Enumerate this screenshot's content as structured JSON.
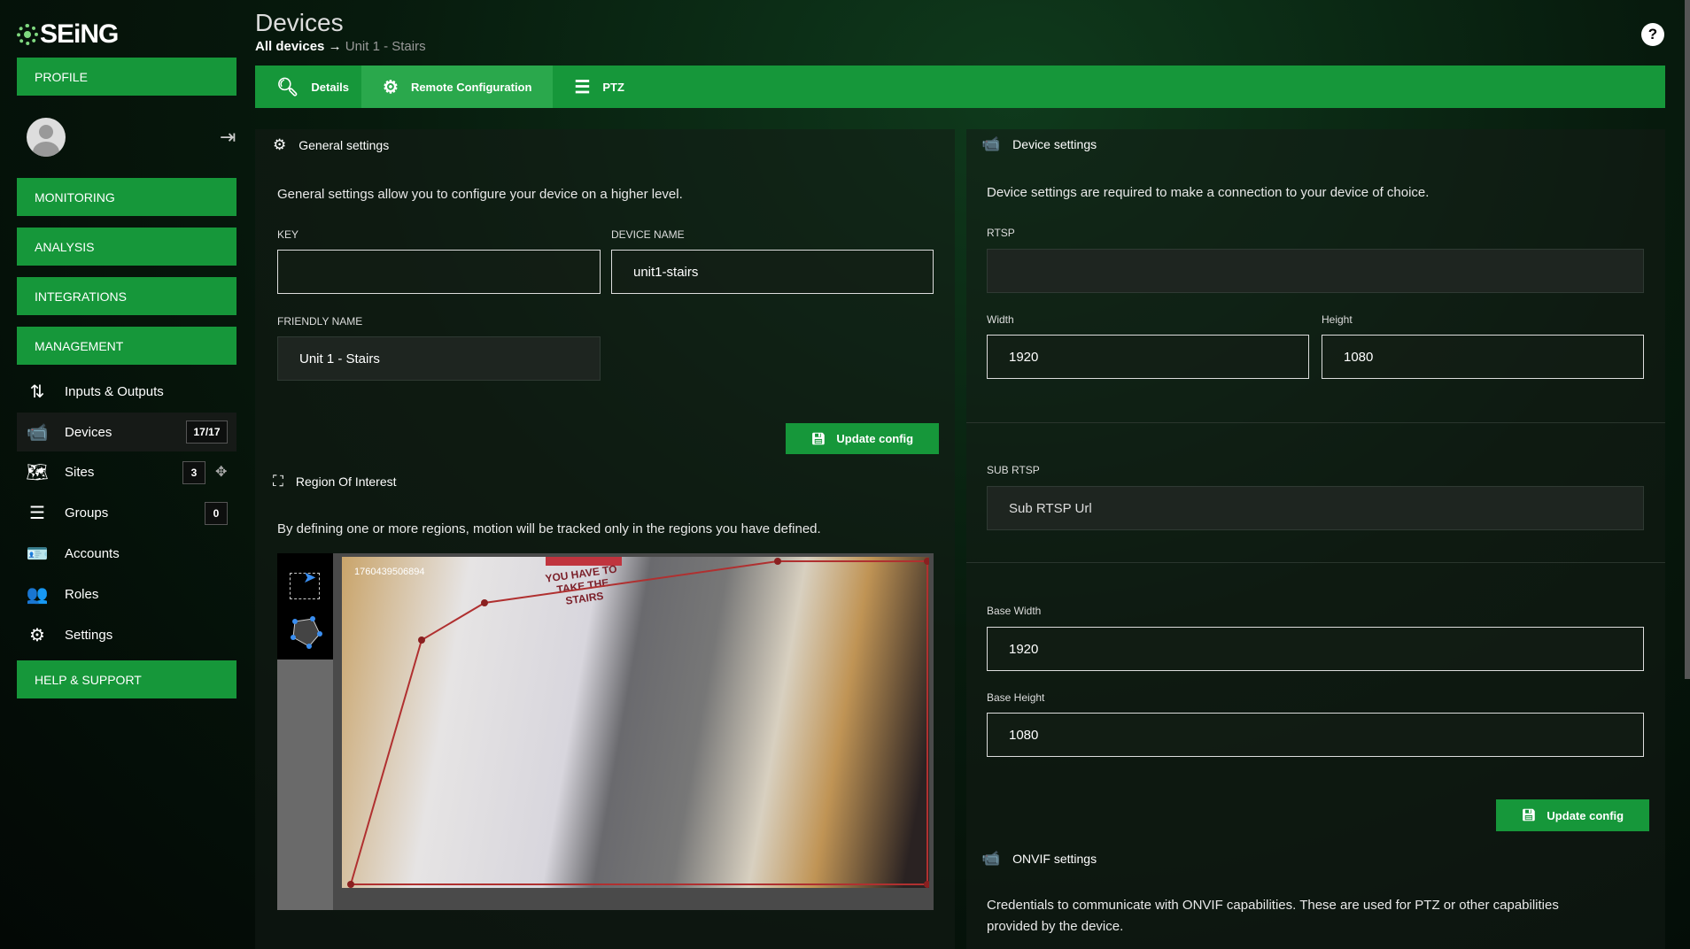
{
  "brand": {
    "name": "SEiNG",
    "accent": "#16973a"
  },
  "sidebar": {
    "profile": "PROFILE",
    "monitoring": "MONITORING",
    "analysis": "ANALYSIS",
    "integrations": "INTEGRATIONS",
    "management": "MANAGEMENT",
    "items": [
      {
        "label": "Inputs & Outputs",
        "icon": "arrows-up-down-icon"
      },
      {
        "label": "Devices",
        "icon": "cctv-camera-icon",
        "badge": "17/17"
      },
      {
        "label": "Sites",
        "icon": "map-icon",
        "badge": "3"
      },
      {
        "label": "Groups",
        "icon": "layers-icon",
        "badge": "0"
      },
      {
        "label": "Accounts",
        "icon": "id-card-icon"
      },
      {
        "label": "Roles",
        "icon": "users-gear-icon"
      },
      {
        "label": "Settings",
        "icon": "gear-icon"
      }
    ],
    "help": "HELP & SUPPORT"
  },
  "header": {
    "title": "Devices",
    "breadcrumb_root": "All devices",
    "breadcrumb_arrow": "→",
    "breadcrumb_current": "Unit 1 - Stairs",
    "help": "?"
  },
  "tabs": [
    {
      "label": "Details"
    },
    {
      "label": "Remote Configuration",
      "active": true
    },
    {
      "label": "PTZ"
    }
  ],
  "general": {
    "title": "General settings",
    "description": "General settings allow you to configure your device on a higher level.",
    "key_label": "KEY",
    "key_value": "",
    "device_name_label": "DEVICE NAME",
    "device_name_value": "unit1-stairs",
    "friendly_name_label": "FRIENDLY NAME",
    "friendly_name_value": "Unit 1 - Stairs",
    "update": "Update config"
  },
  "roi": {
    "title": "Region Of Interest",
    "description": "By defining one or more regions, motion will be tracked only in the regions you have defined.",
    "timestamp": "1760439506894",
    "sign": "YOU HAVE TO TAKE THE STAIRS"
  },
  "device": {
    "title": "Device settings",
    "description": "Device settings are required to make a connection to your device of choice.",
    "rtsp_label": "RTSP",
    "rtsp_value": "",
    "width_label": "Width",
    "width_value": "1920",
    "height_label": "Height",
    "height_value": "1080",
    "sub_rtsp_label": "SUB RTSP",
    "sub_rtsp_placeholder": "Sub RTSP Url",
    "base_width_label": "Base Width",
    "base_width_value": "1920",
    "base_height_label": "Base Height",
    "base_height_value": "1080",
    "update": "Update config"
  },
  "onvif": {
    "title": "ONVIF settings",
    "description_line1": "Credentials to communicate with ONVIF capabilities. These are used for PTZ or other capabilities",
    "description_line2": "provided by the device."
  }
}
